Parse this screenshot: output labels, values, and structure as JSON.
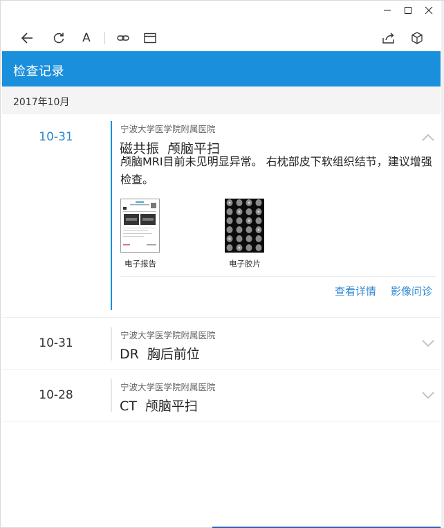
{
  "window": {
    "min_glyph": "—",
    "max_glyph": "☐",
    "close_glyph": "✕"
  },
  "toolbar": {
    "icons": [
      "back-arrow-icon",
      "refresh-icon",
      "font-size-icon",
      "link-icon",
      "window-icon",
      "share-icon",
      "package-icon"
    ],
    "font_glyph": "A"
  },
  "header": {
    "title": "检查记录"
  },
  "month": {
    "label": "2017年10月"
  },
  "records": [
    {
      "date": "10-31",
      "hospital": "宁波大学医学院附属医院",
      "modality": "磁共振",
      "exam": "颅脑平扫",
      "expanded": true,
      "description": "颅脑MRI目前未见明显异常。 右枕部皮下软组织结节，建议增强检查。",
      "attachments": [
        "电子报告",
        "电子胶片"
      ],
      "actions": [
        "查看详情",
        "影像问诊"
      ]
    },
    {
      "date": "10-31",
      "hospital": "宁波大学医学院附属医院",
      "modality": "DR",
      "exam": "胸后前位",
      "expanded": false
    },
    {
      "date": "10-28",
      "hospital": "宁波大学医学院附属医院",
      "modality": "CT",
      "exam": "颅脑平扫",
      "expanded": false
    }
  ],
  "colors": {
    "accent": "#1a8fdc",
    "link": "#2d86cf"
  }
}
